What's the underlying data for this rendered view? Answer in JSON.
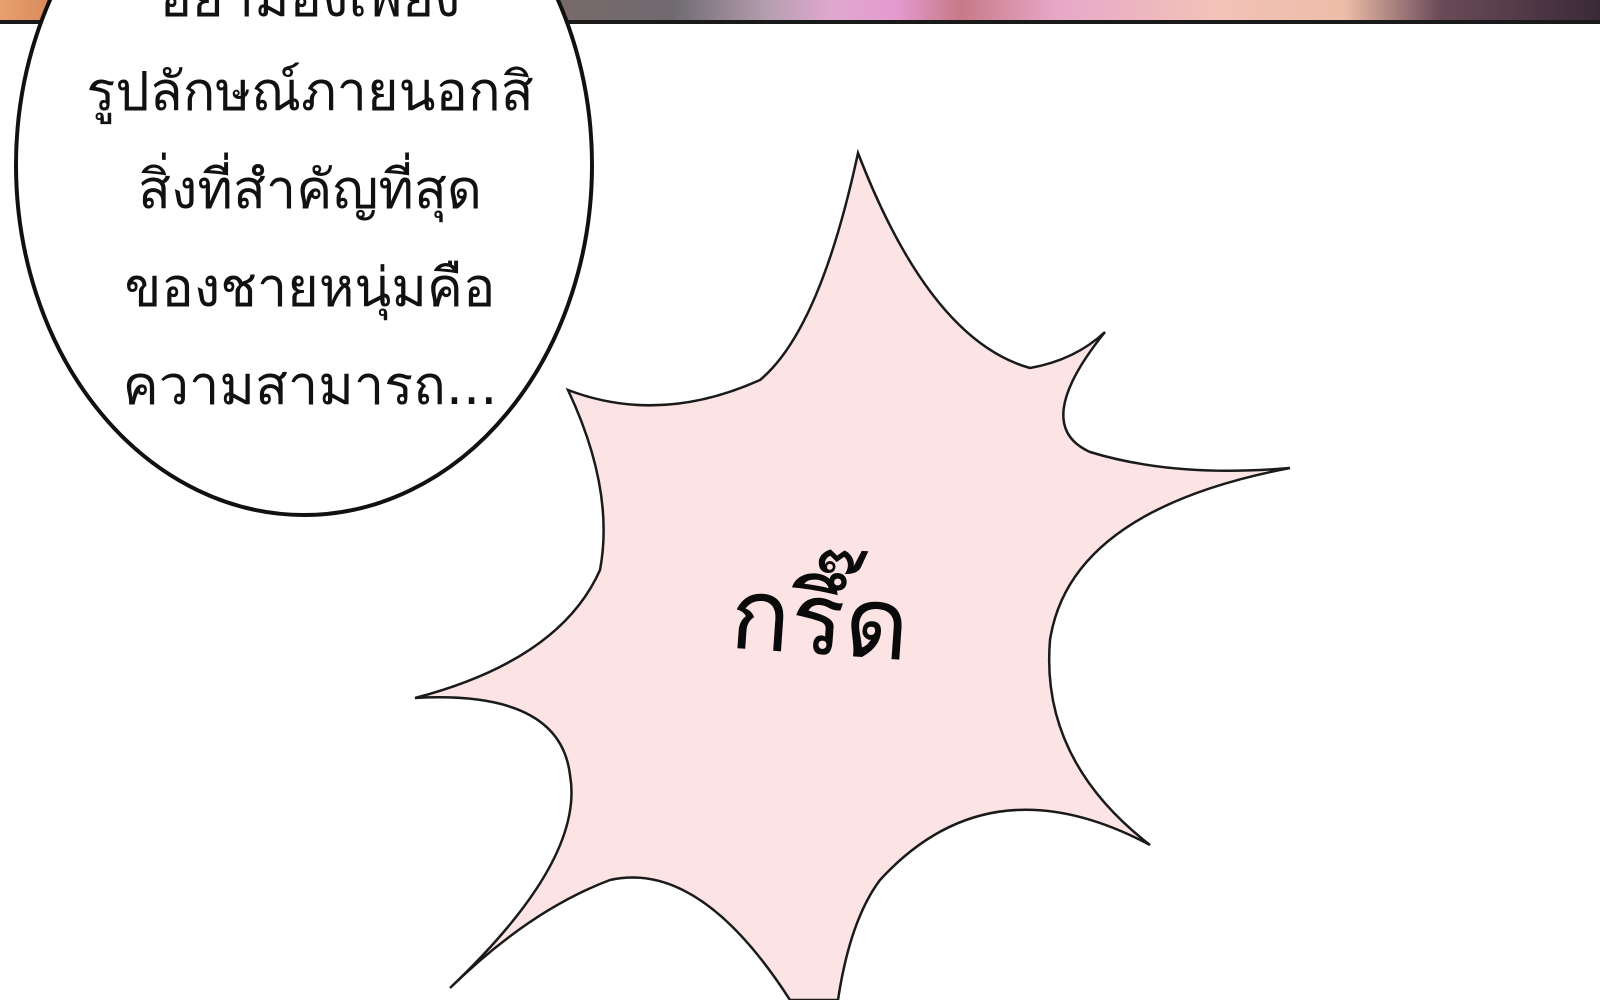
{
  "speech_bubble": {
    "lines": [
      "อย่ามองเพียง",
      "รูปลักษณ์ภายนอกสิ",
      "สิ่งที่สำคัญที่สุด",
      "ของชายหนุ่มคือ",
      "ความสามารถ..."
    ]
  },
  "sound_effect": {
    "text": "กรึ๊ด",
    "burst_color": "#fbe4e3"
  },
  "colors": {
    "background": "#ffffff",
    "outline": "#111111"
  }
}
